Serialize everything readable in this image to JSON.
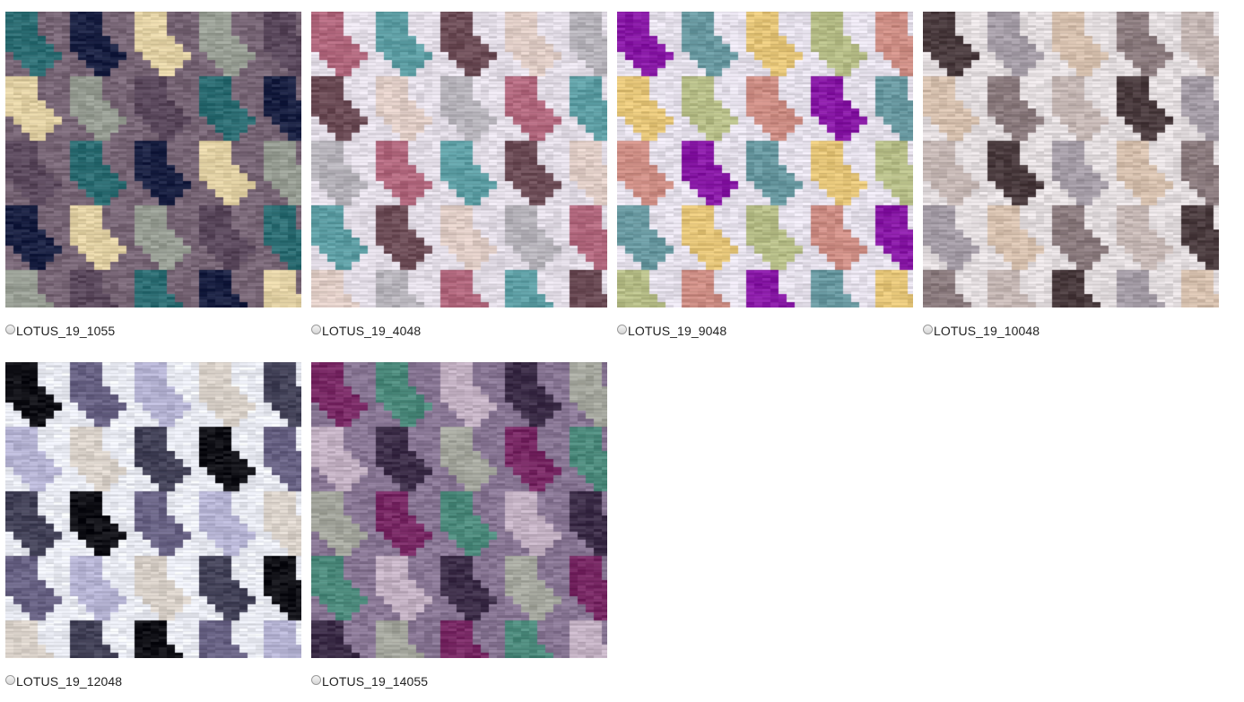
{
  "swatches": [
    {
      "label": "LOTUS_19_1055",
      "colors": [
        "#7a6878",
        "#2e6f75",
        "#1b2244",
        "#e4d3a6",
        "#9aa096",
        "#5c4a5e"
      ]
    },
    {
      "label": "LOTUS_19_4048",
      "colors": [
        "#e6e0ea",
        "#b46a80",
        "#5fa0a6",
        "#6e4e58",
        "#e2cfc8",
        "#b9b6bd"
      ]
    },
    {
      "label": "LOTUS_19_9048",
      "colors": [
        "#e8e3ee",
        "#8a1aa8",
        "#6a9aa2",
        "#e7c77a",
        "#b9c08a",
        "#cf8f86"
      ]
    },
    {
      "label": "LOTUS_19_10048",
      "colors": [
        "#e6e0e2",
        "#4c3d40",
        "#a69ea8",
        "#d8c2b0",
        "#8d7d80",
        "#c7b9b6"
      ]
    },
    {
      "label": "LOTUS_19_12048",
      "colors": [
        "#eceef6",
        "#121218",
        "#6a6486",
        "#b8b6d6",
        "#dcd4cc",
        "#45445a"
      ]
    },
    {
      "label": "LOTUS_19_14055",
      "colors": [
        "#8a7896",
        "#7a2a66",
        "#4e8c7e",
        "#c6b4c6",
        "#3e2f4a",
        "#a7a9a0"
      ]
    }
  ]
}
